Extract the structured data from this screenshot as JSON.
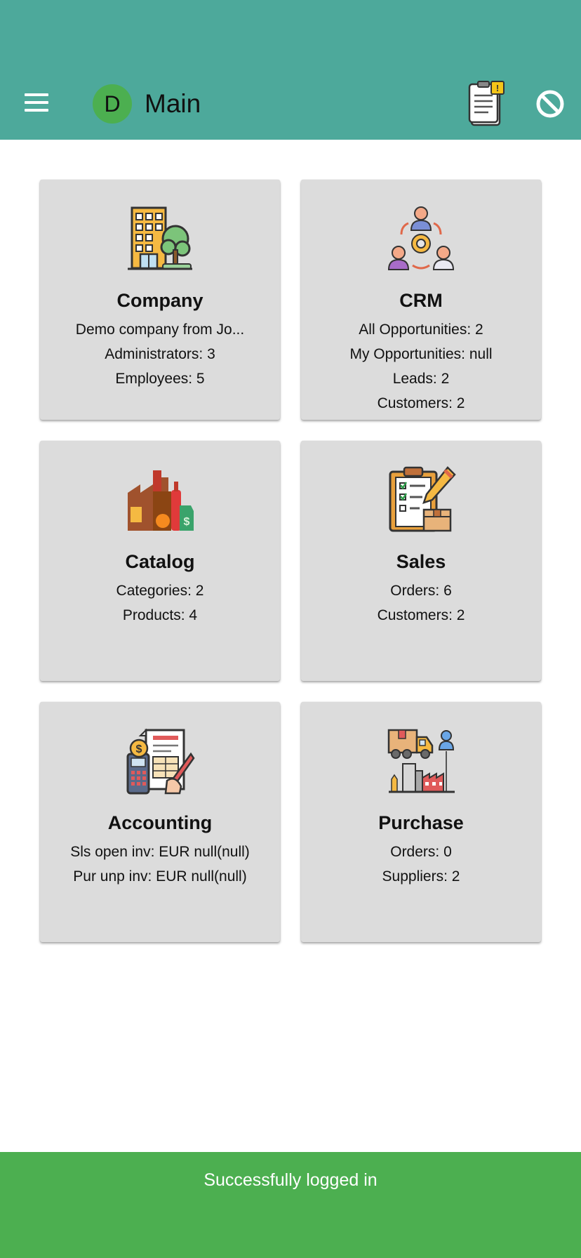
{
  "header": {
    "avatar_initial": "D",
    "title": "Main",
    "menu_icon": "menu-icon",
    "notes_icon": "clipboard-notes-icon",
    "block_icon": "block-icon"
  },
  "colors": {
    "appbar": "#4da99b",
    "avatar": "#4caf50",
    "card": "#dcdcdc",
    "snackbar": "#4caf50"
  },
  "cards": [
    {
      "name": "company",
      "icon": "office-building-icon",
      "title": "Company",
      "lines": [
        "Demo company from Jo...",
        "Administrators: 3",
        "Employees: 5"
      ]
    },
    {
      "name": "crm",
      "icon": "crm-network-icon",
      "title": "CRM",
      "lines": [
        "All Opportunities: 2",
        "My Opportunities: null",
        "Leads: 2",
        "Customers: 2"
      ]
    },
    {
      "name": "catalog",
      "icon": "products-catalog-icon",
      "title": "Catalog",
      "lines": [
        "Categories: 2",
        "Products: 4"
      ]
    },
    {
      "name": "sales",
      "icon": "order-clipboard-icon",
      "title": "Sales",
      "lines": [
        "Orders: 6",
        "Customers: 2"
      ]
    },
    {
      "name": "accounting",
      "icon": "accounting-invoice-icon",
      "title": "Accounting",
      "lines": [
        "Sls open inv: EUR null(null)",
        "Pur unp inv: EUR null(null)"
      ]
    },
    {
      "name": "purchase",
      "icon": "delivery-factory-icon",
      "title": "Purchase",
      "lines": [
        "Orders: 0",
        "Suppliers: 2"
      ]
    }
  ],
  "snackbar": {
    "message": "Successfully logged in"
  }
}
